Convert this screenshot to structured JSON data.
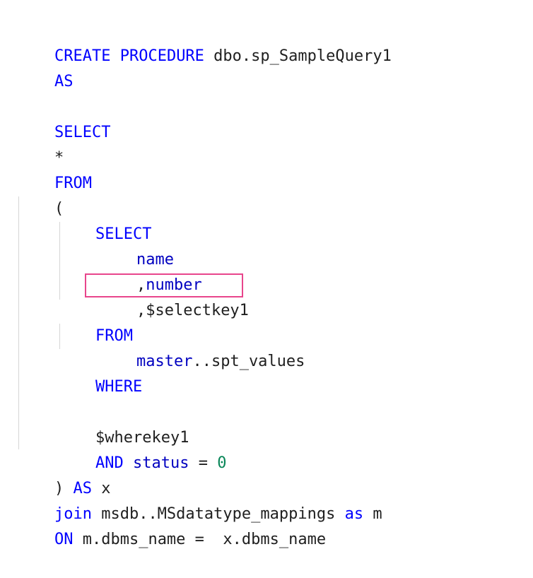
{
  "editor": {
    "accent_color": "#e8458c",
    "keyword_color": "#0000ff",
    "number_color": "#098658",
    "lines": {
      "l1": {
        "kw1": "CREATE",
        "sp1": " ",
        "kw2": "PROCEDURE",
        "rest": " dbo.sp_SampleQuery1"
      },
      "l2": {
        "kw": "AS"
      },
      "l4": {
        "kw": "SELECT"
      },
      "l5": {
        "text": "*"
      },
      "l6": {
        "kw": "FROM"
      },
      "l7": {
        "text": "("
      },
      "l8": {
        "kw": "SELECT"
      },
      "l9": {
        "ident": "name"
      },
      "l10": {
        "comma": ",",
        "ident": "number"
      },
      "l11": {
        "text": ",$selectkey1"
      },
      "l12": {
        "kw": "FROM"
      },
      "l13": {
        "ident": "master",
        "rest": "..spt_values"
      },
      "l14": {
        "kw": "WHERE"
      },
      "l16": {
        "text": "$wherekey1"
      },
      "l17": {
        "kw": "AND",
        "sp": " ",
        "ident": "status",
        "op": " = ",
        "num": "0"
      },
      "l18": {
        "paren": ") ",
        "kw": "AS",
        "rest": " x"
      },
      "l19": {
        "kw": "join",
        "mid": " msdb..MSdatatype_mappings ",
        "kw2": "as",
        "rest": " m"
      },
      "l20": {
        "kw": "ON",
        "rest": " m.dbms_name =  x.dbms_name"
      }
    }
  }
}
